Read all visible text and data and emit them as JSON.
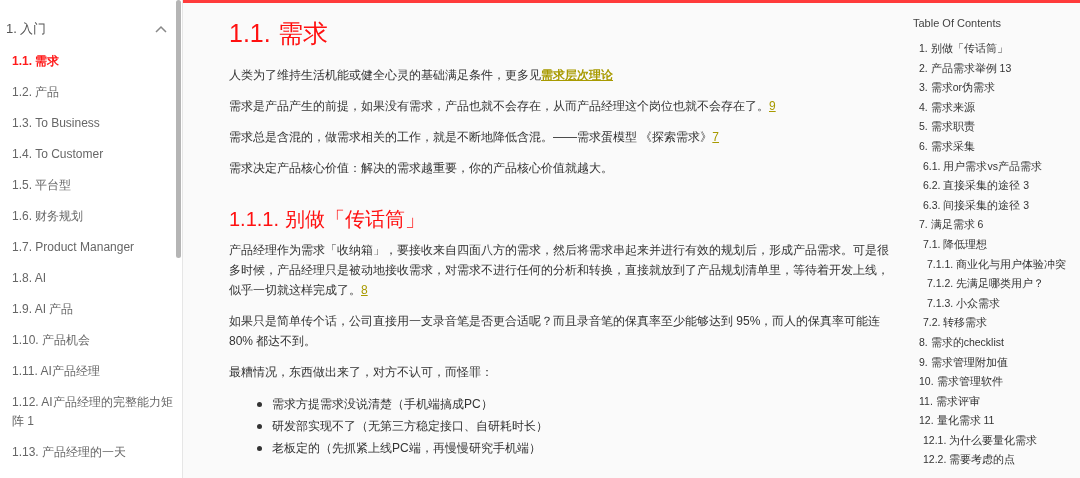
{
  "sidebar": {
    "items": [
      {
        "label": "1. 入门",
        "expanded": true,
        "children": [
          {
            "label": "1.1. 需求",
            "selected": true
          },
          {
            "label": "1.2. 产品",
            "selected": false
          },
          {
            "label": "1.3. To Business",
            "selected": false
          },
          {
            "label": "1.4. To Customer",
            "selected": false
          },
          {
            "label": "1.5. 平台型",
            "selected": false
          },
          {
            "label": "1.6. 财务规划",
            "selected": false
          },
          {
            "label": "1.7. Product Mananger",
            "selected": false
          },
          {
            "label": "1.8. AI",
            "selected": false
          },
          {
            "label": "1.9. AI 产品",
            "selected": false
          },
          {
            "label": "1.10. 产品机会",
            "selected": false
          },
          {
            "label": "1.11. AI产品经理",
            "selected": false
          },
          {
            "label": "1.12. AI产品经理的完整能力矩阵 1",
            "selected": false
          },
          {
            "label": "1.13. 产品经理的一天",
            "selected": false
          }
        ]
      }
    ]
  },
  "article": {
    "title": "1.1. 需求",
    "paragraphs": [
      {
        "text": "人类为了维持生活机能或健全心灵的基础满足条件，更多见",
        "link": "需求层次理论"
      },
      {
        "text": "需求是产品产生的前提，如果没有需求，产品也就不会存在，从而产品经理这个岗位也就不会存在了。",
        "footnote": "9"
      },
      {
        "text": "需求总是含混的，做需求相关的工作，就是不断地降低含混。——需求蛋模型 《探索需求》",
        "footnote": "7"
      },
      {
        "text": "需求决定产品核心价值：解决的需求越重要，你的产品核心价值就越大。"
      }
    ],
    "section": {
      "title": "1.1.1. 别做「传话筒」",
      "paragraphs": [
        {
          "text": "产品经理作为需求「收纳箱」，要接收来自四面八方的需求，然后将需求串起来并进行有效的规划后，形成产品需求。可是很多时候，产品经理只是被动地接收需求，对需求不进行任何的分析和转换，直接就放到了产品规划清单里，等待着开发上线，似乎一切就这样完成了。",
          "footnote": "8"
        },
        {
          "text": "如果只是简单传个话，公司直接用一支录音笔是否更合适呢？而且录音笔的保真率至少能够达到 95%，而人的保真率可能连 80% 都达不到。"
        },
        {
          "text": "最糟情况，东西做出来了，对方不认可，而怪罪："
        }
      ],
      "bullets": [
        "需求方提需求没说清楚（手机端搞成PC）",
        "研发部实现不了（无第三方稳定接口、自研耗时长）",
        "老板定的（先抓紧上线PC端，再慢慢研究手机端）"
      ]
    }
  },
  "toc": {
    "title": "Table Of Contents",
    "items": [
      {
        "label": "1. 别做「传话筒」"
      },
      {
        "label": "2. 产品需求举例 13"
      },
      {
        "label": "3. 需求or伪需求"
      },
      {
        "label": "4. 需求来源"
      },
      {
        "label": "5. 需求职责"
      },
      {
        "label": "6. 需求采集",
        "children": [
          {
            "label": "6.1. 用户需求vs产品需求"
          },
          {
            "label": "6.2. 直接采集的途径 3"
          },
          {
            "label": "6.3. 间接采集的途径 3"
          }
        ]
      },
      {
        "label": "7. 满足需求 6",
        "children": [
          {
            "label": "7.1. 降低理想",
            "children": [
              {
                "label": "7.1.1. 商业化与用户体验冲突"
              },
              {
                "label": "7.1.2. 先满足哪类用户？"
              },
              {
                "label": "7.1.3. 小众需求"
              }
            ]
          },
          {
            "label": "7.2. 转移需求"
          }
        ]
      },
      {
        "label": "8. 需求的checklist"
      },
      {
        "label": "9. 需求管理附加值"
      },
      {
        "label": "10. 需求管理软件"
      },
      {
        "label": "11. 需求评审"
      },
      {
        "label": "12. 量化需求 11",
        "children": [
          {
            "label": "12.1. 为什么要量化需求"
          },
          {
            "label": "12.2. 需要考虑的点"
          }
        ]
      }
    ]
  }
}
